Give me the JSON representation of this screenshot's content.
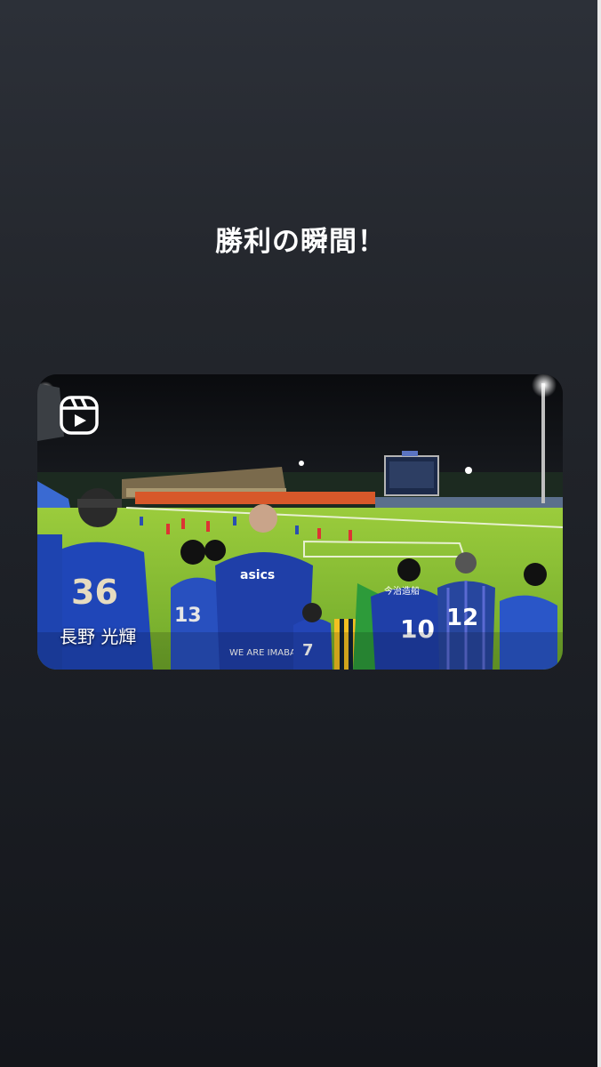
{
  "story": {
    "caption": "勝利の瞬間！"
  },
  "reel": {
    "icon": "reels-icon",
    "author_name": "長野 光輝",
    "jersey_numbers": [
      "36",
      "13",
      "7",
      "10",
      "12"
    ],
    "shirt_texts": [
      "asics",
      "WE ARE IMABARI",
      "今治造船"
    ]
  },
  "colors": {
    "background_top": "#2c3038",
    "background_bottom": "#14161b",
    "text": "#ffffff",
    "pitch": "#8fc23a",
    "jersey": "#1f3fa8"
  }
}
